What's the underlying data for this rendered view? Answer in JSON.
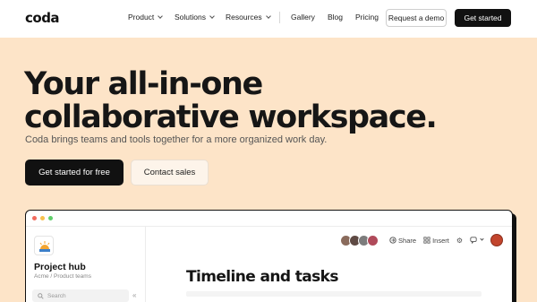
{
  "nav": {
    "logo": "coda",
    "items": [
      {
        "label": "Product",
        "dropdown": true
      },
      {
        "label": "Solutions",
        "dropdown": true
      },
      {
        "label": "Resources",
        "dropdown": true
      },
      {
        "label": "Gallery"
      },
      {
        "label": "Blog"
      },
      {
        "label": "Pricing"
      }
    ],
    "request_demo": "Request a demo",
    "get_started": "Get started"
  },
  "hero": {
    "headline_line1": "Your all-in-one",
    "headline_line2": "collaborative workspace.",
    "subtitle": "Coda brings teams and tools together for a more organized work day.",
    "cta_primary": "Get started for free",
    "cta_secondary": "Contact sales"
  },
  "app": {
    "window_dots": [
      "#f26b5e",
      "#f7c14e",
      "#5fcf6a"
    ],
    "sidebar": {
      "doc_title": "Project hub",
      "doc_subtitle": "Acme / Product teams",
      "search_placeholder": "Search",
      "collapse_icon": "chevrons-left-icon"
    },
    "toolbar": {
      "avatar_colors": [
        "#8a6b5c",
        "#5f4a44",
        "#7c7c7c",
        "#b04a5a"
      ],
      "share": "Share",
      "insert": "Insert"
    },
    "page_title": "Timeline and tasks"
  },
  "colors": {
    "hero_background": "#fde4c8",
    "primary_button": "#111111"
  }
}
